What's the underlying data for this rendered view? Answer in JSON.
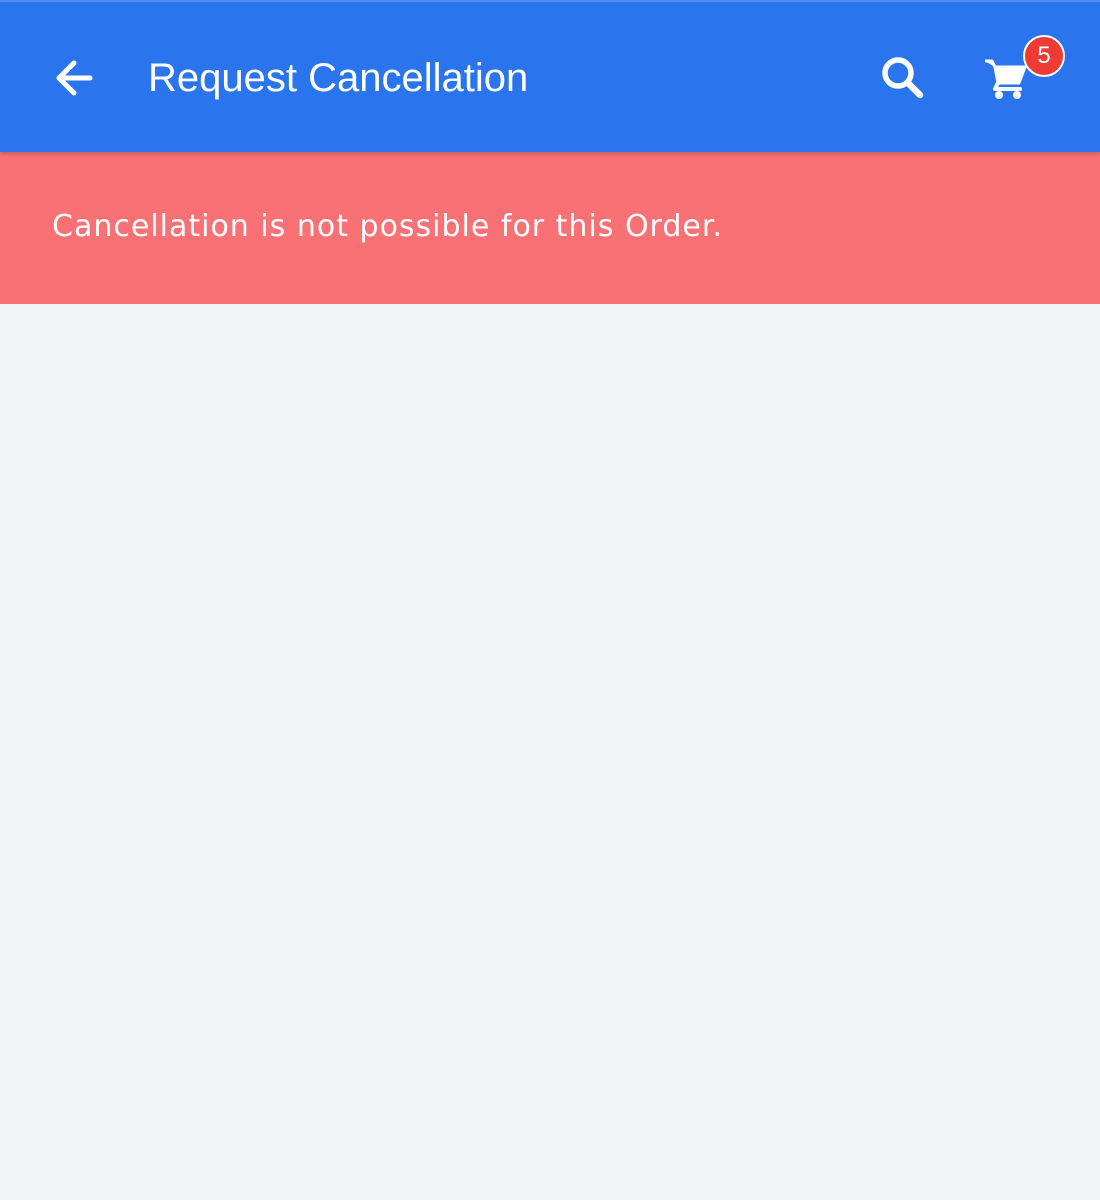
{
  "appbar": {
    "title": "Request Cancellation",
    "back_icon": "arrow-left-icon",
    "search_icon": "search-icon",
    "cart_icon": "cart-icon",
    "cart_count": "5",
    "bar_color": "#2a75ee",
    "badge_color": "#ef3b36"
  },
  "alert": {
    "message": "Cancellation is not possible for this Order.",
    "background_color": "#f97174"
  }
}
